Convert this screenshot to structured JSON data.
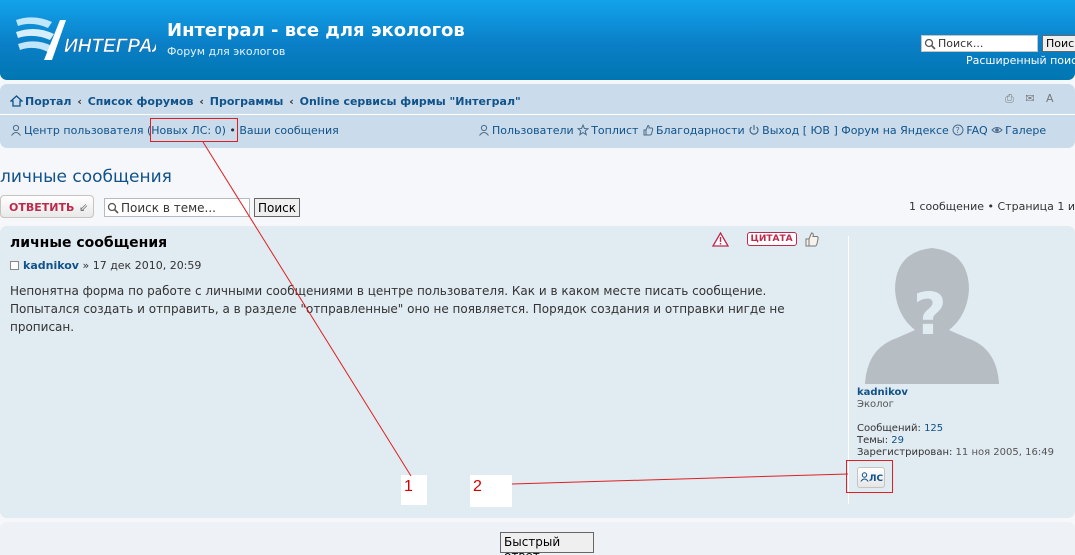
{
  "header": {
    "title": "Интеграл - все для экологов",
    "description": "Форум для экологов",
    "search_placeholder": "Поиск...",
    "search_button": "Поис",
    "advanced_search": "Расширенный поис"
  },
  "breadcrumbs": [
    "Портал",
    "Список форумов",
    "Программы",
    "Online сервисы фирмы \"Интеграл\""
  ],
  "breadcrumb_seps": [
    "»",
    "‹",
    "‹",
    "‹"
  ],
  "tools": {
    "print": "⎙",
    "email": "✉",
    "font": "A"
  },
  "usernav": {
    "ucp": "Центр пользователя",
    "new_pm": "(Новых ЛС: 0)",
    "bullet": "•",
    "your_posts": "Ваши сообщения",
    "members": "Пользователи",
    "toplist": "Топлист",
    "thanks": "Благодарности",
    "logout": "Выход",
    "logout_user": "[ ЮВ ]",
    "yandex": "Форум на Яндексе",
    "faq": "FAQ",
    "gallery": "Галере"
  },
  "topic": {
    "title": "личные сообщения",
    "reply_button": "ОТВЕТИТЬ",
    "reply_arrow": "⇙",
    "search_placeholder": "Поиск в теме...",
    "search_button": "Поиск",
    "pagination": "1 сообщение • Страница 1 и"
  },
  "post": {
    "title": "личные сообщения",
    "author": "kadnikov",
    "date": "» 17 дек 2010, 20:59",
    "body": "Непонятна форма по работе с личными сообщениями в центре пользователя. Как и в каком месте писать сообщение. Попытался создать и отправить, а в разделе \"отправленные\" оно не появляется. Порядок создания и отправки нигде не прописан.",
    "quote_button": "ЦИТАТА"
  },
  "profile": {
    "username": "kadnikov",
    "rank": "Эколог",
    "posts_label": "Сообщений:",
    "posts_value": "125",
    "topics_label": "Темы:",
    "topics_value": "29",
    "registered_label": "Зарегистрирован:",
    "registered_value": "11 ноя 2005, 16:49",
    "pm_button": "ЛС"
  },
  "quick_reply": "Быстрый ответ",
  "annotations": {
    "label1": "1",
    "label2": "2"
  },
  "colors": {
    "header_blue": "#0a7fc7",
    "navbar": "#cadceb",
    "post_bg": "#e1ebf2",
    "link": "#105289",
    "accent_red": "#bc2a4d",
    "annotation_red": "#e02020"
  }
}
